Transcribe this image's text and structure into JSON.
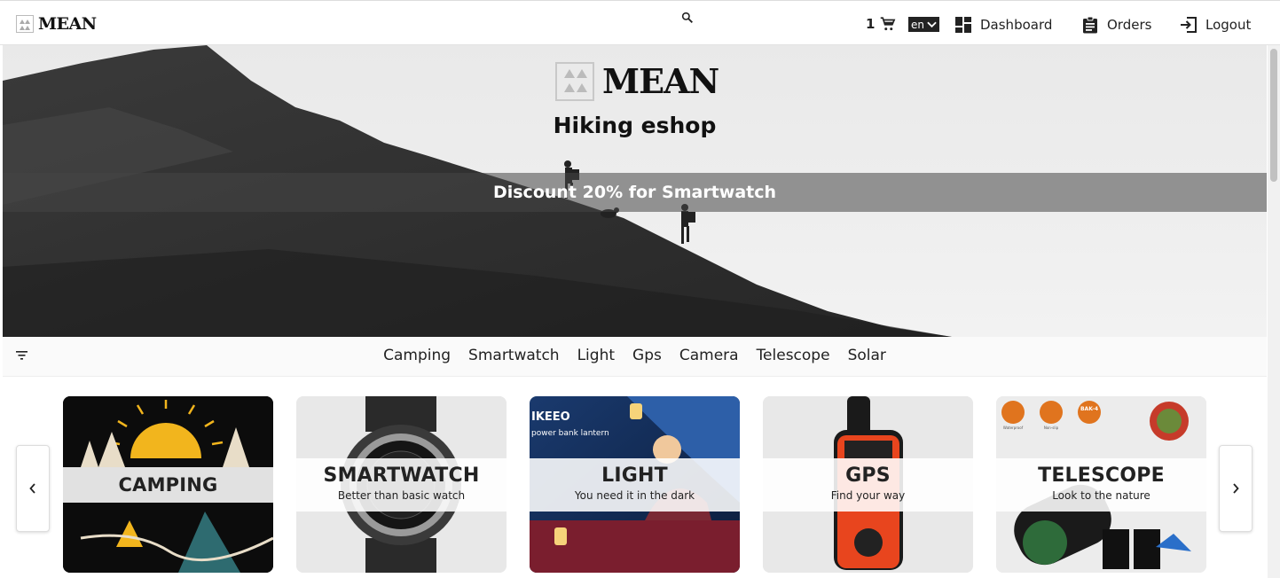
{
  "header": {
    "brand": "MEAN",
    "cart_count": "1",
    "language": "en",
    "nav": {
      "dashboard": "Dashboard",
      "orders": "Orders",
      "logout": "Logout"
    },
    "icons": [
      "logo-icon",
      "search-icon",
      "cart-icon",
      "dashboard-icon",
      "orders-icon",
      "logout-icon"
    ]
  },
  "hero": {
    "brand": "MEAN",
    "subtitle": "Hiking eshop",
    "banner": "Discount 20% for Smartwatch"
  },
  "categories": [
    "Camping",
    "Smartwatch",
    "Light",
    "Gps",
    "Camera",
    "Telescope",
    "Solar"
  ],
  "cards": [
    {
      "title": "CAMPING",
      "description": ""
    },
    {
      "title": "SMARTWATCH",
      "description": "Better than basic watch"
    },
    {
      "title": "LIGHT",
      "description": "You need it in the dark"
    },
    {
      "title": "GPS",
      "description": "Find your way"
    },
    {
      "title": "TELESCOPE",
      "description": "Look to the nature"
    }
  ],
  "card_image_text": {
    "light_brand": "IKEEO",
    "light_caption": "power bank lantern",
    "telescope_badges": [
      "Waterproof",
      "Non-slip",
      "BAK-4"
    ]
  },
  "colors": {
    "header_bg": "#ffffff",
    "banner_bg": "#555555",
    "gps_orange": "#e8451e",
    "camping_yellow": "#f2b51d"
  }
}
